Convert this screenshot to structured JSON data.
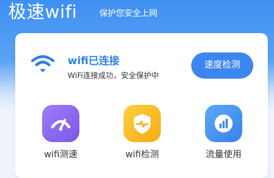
{
  "header": {
    "title": "极速wifi",
    "subtitle": "保护您安全上网"
  },
  "status_card": {
    "icon": "wifi-icon",
    "title": "wifi已连接",
    "description": "WiFi连接成功，安全保护中",
    "speed_button_label": "速度检测"
  },
  "features": [
    {
      "label": "wifi测速",
      "icon": "speedometer-icon",
      "color": "#8a66f0"
    },
    {
      "label": "wifi检测",
      "icon": "shield-pulse-icon",
      "color": "#f9b926"
    },
    {
      "label": "流量使用",
      "icon": "bar-chart-icon",
      "color": "#4893f0"
    }
  ],
  "colors": {
    "brand": "#3e8ff2",
    "accent_text": "#2f7fe6",
    "button": "#3d86ee"
  }
}
